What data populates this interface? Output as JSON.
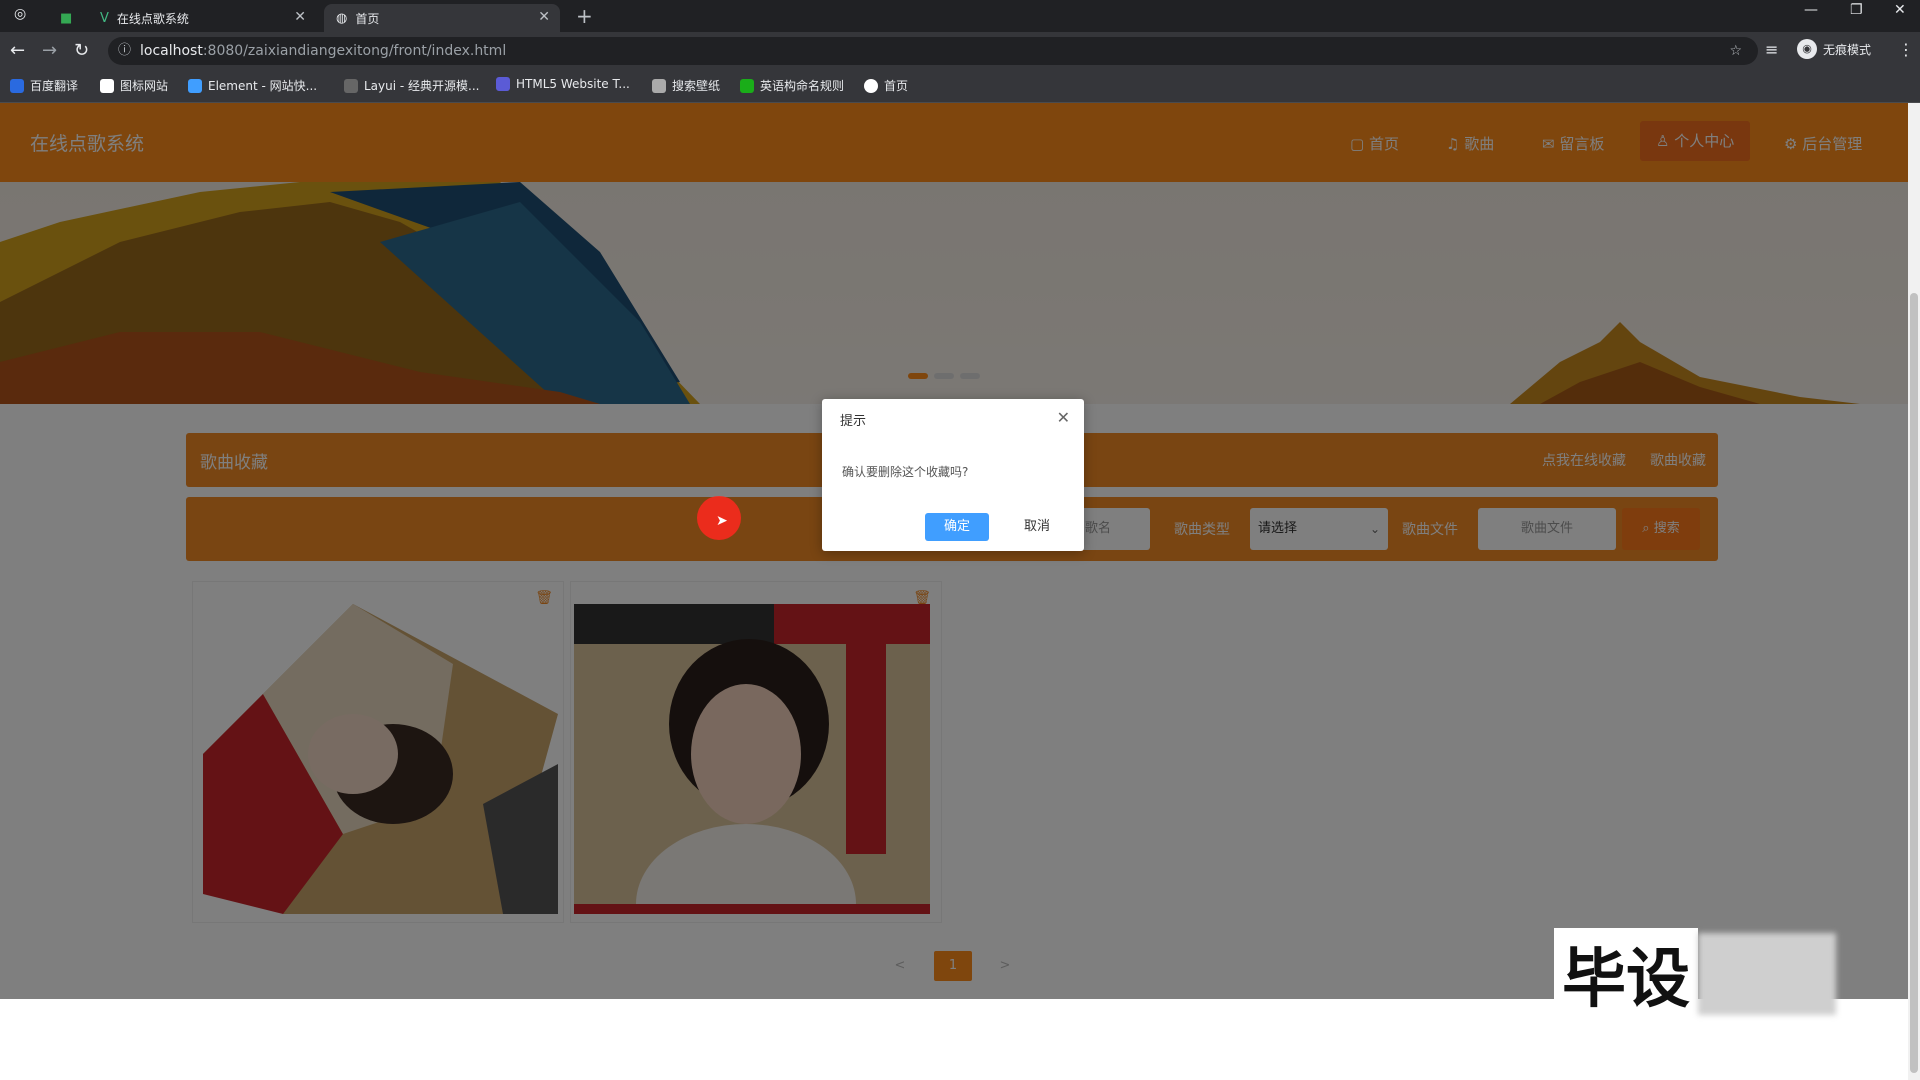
{
  "browser": {
    "tabs": [
      {
        "title": ""
      },
      {
        "title": "在线点歌系统"
      },
      {
        "title": "首页"
      }
    ],
    "url_host": "localhost",
    "url_path": ":8080/zaixiandiangexitong/front/index.html",
    "incognito_label": "无痕模式",
    "bookmarks": [
      "百度翻译",
      "图标网站",
      "Element - 网站快...",
      "Layui - 经典开源模...",
      "HTML5 Website T...",
      "搜索壁纸",
      "英语构命名规则",
      "首页"
    ]
  },
  "header": {
    "brand": "在线点歌系统",
    "nav": [
      "首页",
      "歌曲",
      "留言板",
      "个人中心",
      "后台管理"
    ]
  },
  "section": {
    "title": "歌曲收藏",
    "right_links": [
      "点我在线收藏",
      "歌曲收藏"
    ]
  },
  "search": {
    "name_placeholder": "歌名",
    "type_label": "歌曲类型",
    "type_value": "请选择",
    "file_label": "歌曲文件",
    "file_placeholder": "歌曲文件",
    "button": "搜索"
  },
  "pagination": {
    "current": "1",
    "prev": "<",
    "next": ">"
  },
  "dialog": {
    "title": "提示",
    "message": "确认要删除这个收藏吗?",
    "ok": "确定",
    "cancel": "取消"
  },
  "watermark": "毕设",
  "colors": {
    "brand": "#ff8c1a",
    "primary_button": "#409eff"
  }
}
